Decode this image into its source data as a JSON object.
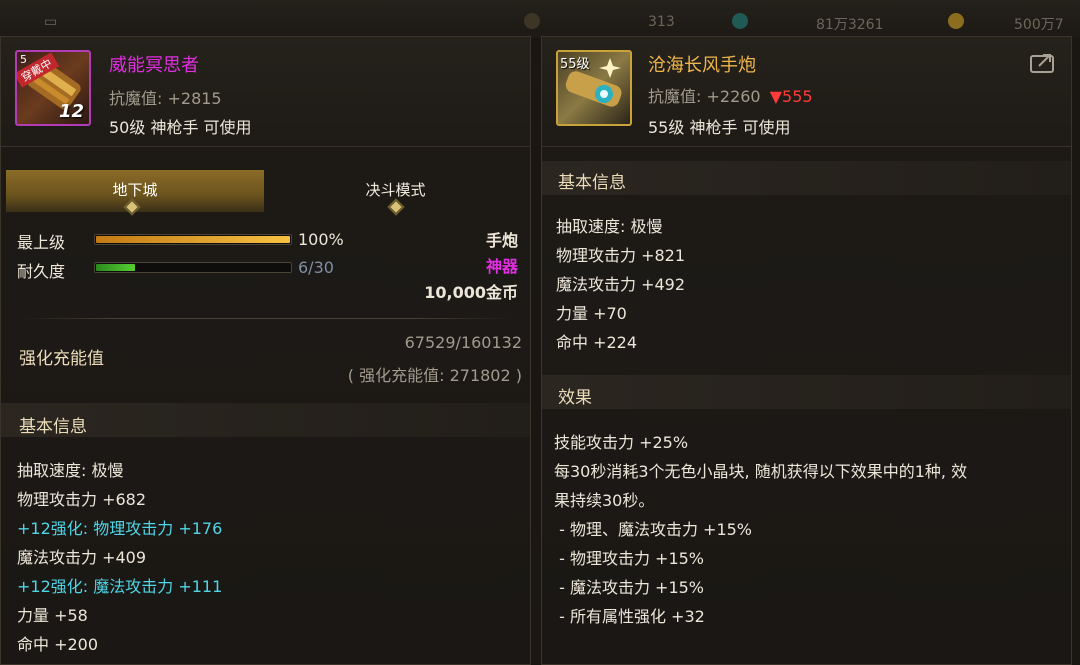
{
  "hud": {
    "count_a": "313",
    "count_b": "81万3261",
    "count_c": "500万7"
  },
  "left": {
    "badge_label": "穿戴中",
    "level_tag": "5",
    "upgrade_level": "12",
    "name": "威能冥思者",
    "resist": "抗魔值: +2815",
    "req": "50级 神枪手 可使用",
    "tabs": [
      "地下城",
      "决斗模式"
    ],
    "top_label": "最上级",
    "top_value": "100%",
    "top_fraction": 1.0,
    "durability_label": "耐久度",
    "durability_value": "6/30",
    "durability_fraction": 0.2,
    "weapon_type": "手炮",
    "rarity": "神器",
    "price": "10,000金币",
    "charge_title": "强化充能值",
    "charge_value": "67529/160132",
    "charge_sub": "( 强化充能值: 271802 )",
    "basic_title": "基本信息",
    "stats": [
      {
        "text": "抽取速度: 极慢",
        "color": "white"
      },
      {
        "text": "物理攻击力 +682",
        "color": "white"
      },
      {
        "text": "+12强化: 物理攻击力 +176",
        "color": "cyan"
      },
      {
        "text": "魔法攻击力 +409",
        "color": "white"
      },
      {
        "text": "+12强化: 魔法攻击力 +111",
        "color": "cyan"
      },
      {
        "text": "力量 +58",
        "color": "white"
      },
      {
        "text": "命中 +200",
        "color": "white"
      }
    ]
  },
  "right": {
    "level_tag": "55级",
    "name": "沧海长风手炮",
    "resist": "抗魔值: +2260",
    "resist_diff": "▼555",
    "req": "55级 神枪手 可使用",
    "basic_title": "基本信息",
    "stats": [
      "抽取速度: 极慢",
      "物理攻击力 +821",
      "魔法攻击力 +492",
      "力量 +70",
      "命中 +224"
    ],
    "effect_title": "效果",
    "effects": [
      "技能攻击力 +25%",
      "每30秒消耗3个无色小晶块, 随机获得以下效果中的1种, 效",
      "果持续30秒。",
      " - 物理、魔法攻击力 +15%",
      " - 物理攻击力 +15%",
      " - 魔法攻击力 +15%",
      " - 所有属性强化 +32"
    ]
  },
  "colors": {
    "epic_magenta": "#e02ee0",
    "legendary_orange": "#f0b64b",
    "upgrade_cyan": "#4fd5e6",
    "decrease_red": "#ff3b3b"
  }
}
